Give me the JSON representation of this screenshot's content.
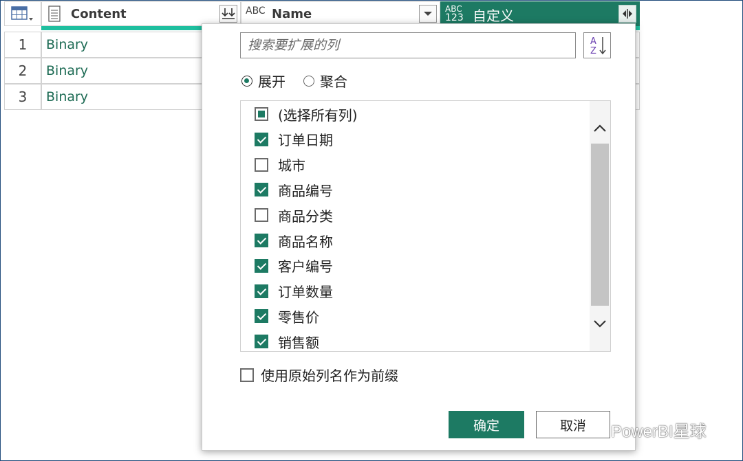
{
  "grid": {
    "columns": [
      {
        "type": "document",
        "label": "Content"
      },
      {
        "type": "ABC",
        "label": "Name"
      },
      {
        "type_top": "ABC",
        "type_bottom": "123",
        "label": "自定义"
      }
    ],
    "rows": [
      {
        "num": "1",
        "content": "Binary"
      },
      {
        "num": "2",
        "content": "Binary"
      },
      {
        "num": "3",
        "content": "Binary"
      }
    ]
  },
  "dialog": {
    "search_placeholder": "搜索要扩展的列",
    "mode_expand": "展开",
    "mode_aggregate": "聚合",
    "selected_mode": "展开",
    "items": [
      {
        "label": "(选择所有列)",
        "state": "partial"
      },
      {
        "label": "订单日期",
        "state": "checked"
      },
      {
        "label": "城市",
        "state": "unchecked"
      },
      {
        "label": "商品编号",
        "state": "checked"
      },
      {
        "label": "商品分类",
        "state": "unchecked"
      },
      {
        "label": "商品名称",
        "state": "checked"
      },
      {
        "label": "客户编号",
        "state": "checked"
      },
      {
        "label": "订单数量",
        "state": "checked"
      },
      {
        "label": "零售价",
        "state": "checked"
      },
      {
        "label": "销售额",
        "state": "checked"
      }
    ],
    "prefix_label": "使用原始列名作为前缀",
    "prefix_checked": false,
    "ok_label": "确定",
    "cancel_label": "取消"
  },
  "watermark": "PowerBI星球",
  "colors": {
    "accent": "#1d7a63",
    "teal_bar": "#1fbf9f"
  }
}
